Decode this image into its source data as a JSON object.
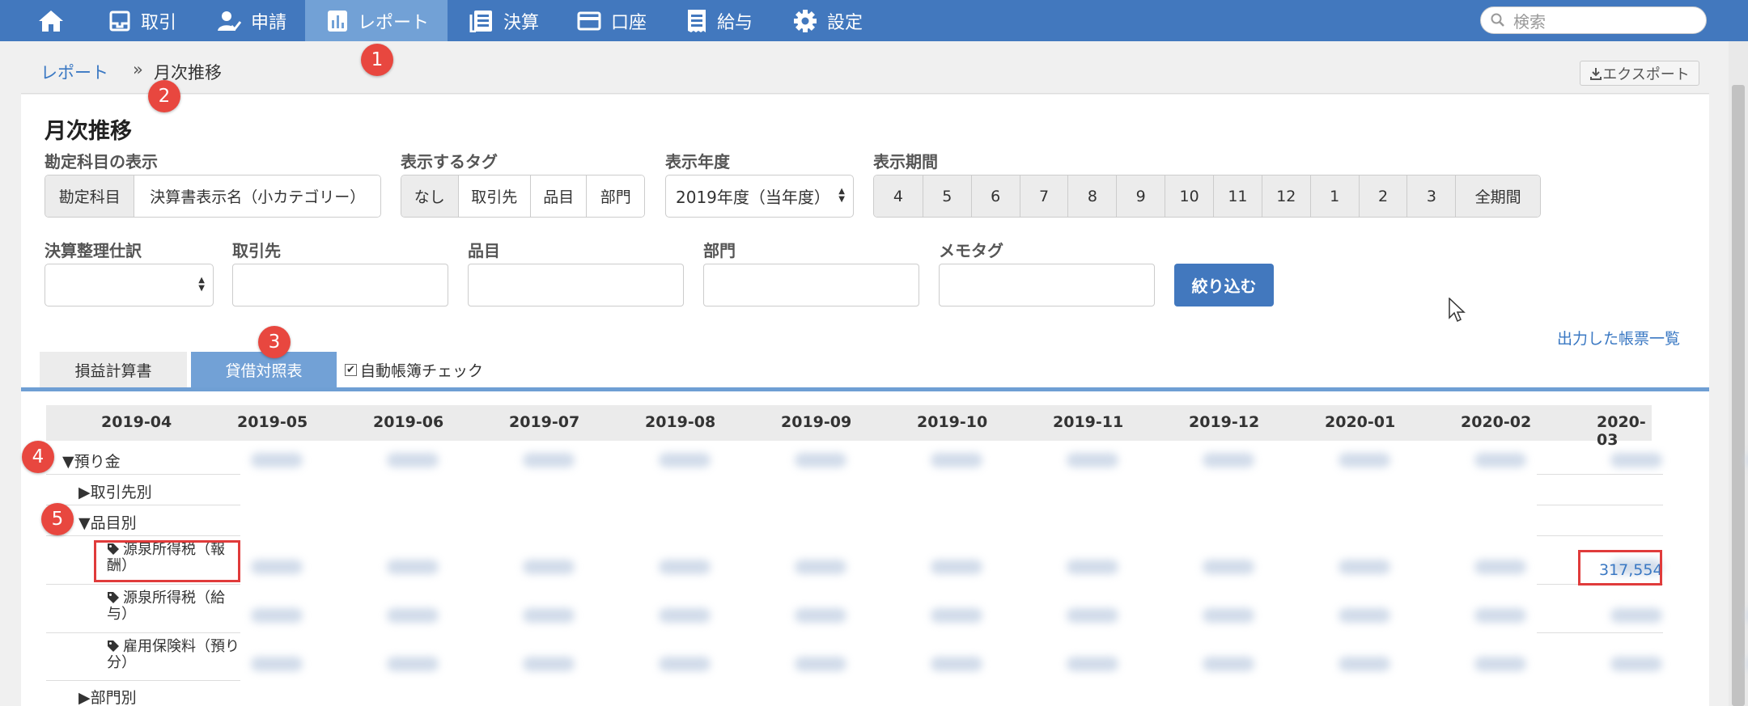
{
  "nav": {
    "home_icon": "home-icon",
    "items": [
      {
        "label": "取引",
        "icon": "ledger-icon"
      },
      {
        "label": "申請",
        "icon": "user-check-icon"
      },
      {
        "label": "レポート",
        "icon": "bar-chart-icon",
        "active": true
      },
      {
        "label": "決算",
        "icon": "document-list-icon"
      },
      {
        "label": "口座",
        "icon": "credit-card-icon"
      },
      {
        "label": "給与",
        "icon": "receipt-icon"
      },
      {
        "label": "設定",
        "icon": "gear-icon"
      }
    ],
    "search_placeholder": "検索",
    "accent_color": "#4278be",
    "active_color": "#72a1d6"
  },
  "breadcrumb": {
    "parent": "レポート",
    "separator": "»",
    "current": "月次推移"
  },
  "export_label": "エクスポート",
  "title": "月次推移",
  "filters": {
    "account_display": {
      "label": "勘定科目の表示",
      "options": [
        "勘定科目",
        "決算書表示名（小カテゴリー）"
      ]
    },
    "tags": {
      "label": "表示するタグ",
      "options": [
        "なし",
        "取引先",
        "品目",
        "部門"
      ]
    },
    "year": {
      "label": "表示年度",
      "value": "2019年度（当年度）"
    },
    "period": {
      "label": "表示期間",
      "options": [
        "4",
        "5",
        "6",
        "7",
        "8",
        "9",
        "10",
        "11",
        "12",
        "1",
        "2",
        "3",
        "全期間"
      ]
    },
    "closing_entries": {
      "label": "決算整理仕訳",
      "value": ""
    },
    "partner": {
      "label": "取引先",
      "value": ""
    },
    "item": {
      "label": "品目",
      "value": ""
    },
    "department": {
      "label": "部門",
      "value": ""
    },
    "memo_tag": {
      "label": "メモタグ",
      "value": ""
    },
    "submit_label": "絞り込む"
  },
  "output_list_link": "出力した帳票一覧",
  "tabs": {
    "pl": "損益計算書",
    "bs": "貸借対照表",
    "auto_check": "自動帳簿チェック"
  },
  "table": {
    "months": [
      "2019-04",
      "2019-05",
      "2019-06",
      "2019-07",
      "2019-08",
      "2019-09",
      "2019-10",
      "2019-11",
      "2019-12",
      "2020-01",
      "2020-02",
      "2020-03"
    ],
    "rows": [
      {
        "label": "▼預り金"
      },
      {
        "label": "▶取引先別"
      },
      {
        "label": "▼品目別"
      },
      {
        "label": "源泉所得税（報酬）"
      },
      {
        "label": "源泉所得税（給与）"
      },
      {
        "label": "雇用保険料（預り分）"
      },
      {
        "label": "▶部門別"
      }
    ],
    "highlight_value": "317,554"
  },
  "annotations": [
    "1",
    "2",
    "3",
    "4",
    "5"
  ],
  "annotation_color": "#e8473f"
}
